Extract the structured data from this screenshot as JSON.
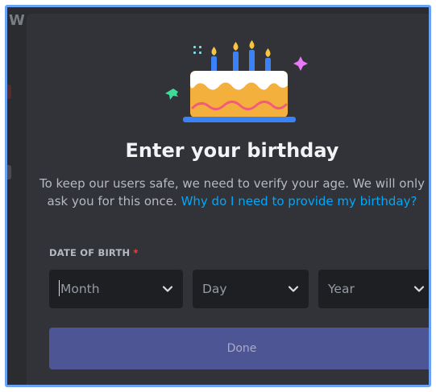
{
  "background": {
    "partial_title": "W"
  },
  "illustration": {
    "icon": "birthday-cake-icon",
    "colors": {
      "cake": "#f3b03c",
      "frosting": "#ffffff",
      "plate": "#3b82f6",
      "wave": "#f25c7a",
      "candles": "#3b82f6",
      "flames": "#f6c343",
      "sparkle_pink": "#e879f9",
      "sparkle_green": "#3ddc97",
      "sparkle_cyan": "#7ddde8"
    }
  },
  "dialog": {
    "title": "Enter your birthday",
    "description": "To keep our users safe, we need to verify your age. We will only ask you for this once.",
    "help_link": "Why do I need to provide my birthday?",
    "dob_label": "DATE OF BIRTH",
    "required_mark": "*",
    "selects": {
      "month": {
        "placeholder": "Month",
        "icon": "chevron-down-icon"
      },
      "day": {
        "placeholder": "Day",
        "icon": "chevron-down-icon"
      },
      "year": {
        "placeholder": "Year",
        "icon": "chevron-down-icon"
      }
    },
    "done_label": "Done"
  },
  "colors": {
    "frame_border": "#6aa2f5",
    "dialog_bg": "#313338",
    "input_bg": "#1e1f22",
    "link": "#00a8fc",
    "required": "#f23f43",
    "button_disabled": "#4e5595"
  }
}
